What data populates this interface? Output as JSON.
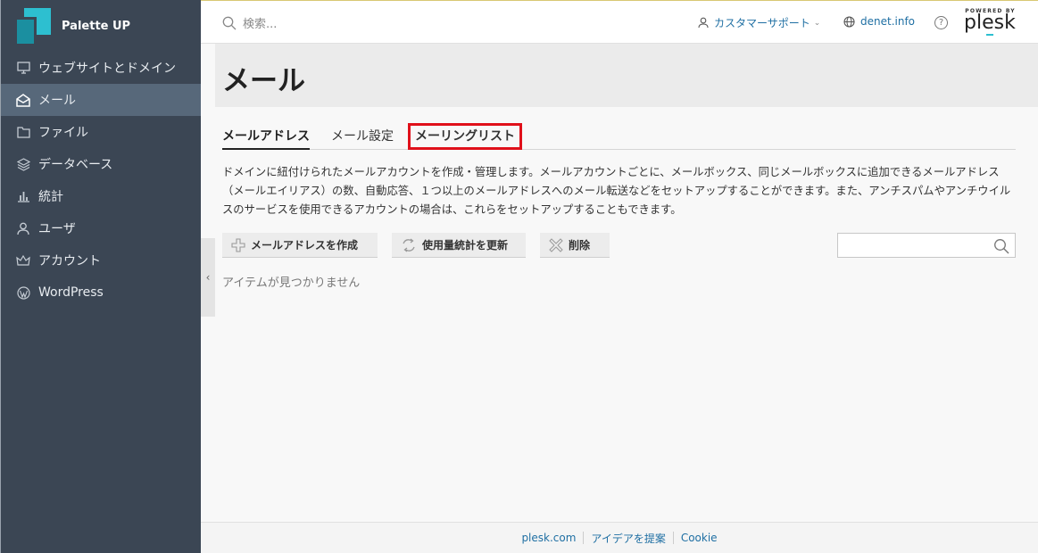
{
  "brand": {
    "name": "Palette UP"
  },
  "sidebar": {
    "items": [
      {
        "label": "ウェブサイトとドメイン",
        "icon": "monitor-icon"
      },
      {
        "label": "メール",
        "icon": "mail-icon",
        "active": true
      },
      {
        "label": "ファイル",
        "icon": "folder-icon"
      },
      {
        "label": "データベース",
        "icon": "layers-icon"
      },
      {
        "label": "統計",
        "icon": "bar-chart-icon"
      },
      {
        "label": "ユーザ",
        "icon": "user-icon"
      },
      {
        "label": "アカウント",
        "icon": "crown-icon"
      },
      {
        "label": "WordPress",
        "icon": "wordpress-icon"
      }
    ]
  },
  "header": {
    "search_placeholder": "検索...",
    "support_label": "カスタマーサポート",
    "domain_label": "denet.info",
    "help_label": "?",
    "plesk_small": "POWERED BY",
    "plesk_word": "plesk"
  },
  "main": {
    "title": "メール",
    "tabs": [
      {
        "label": "メールアドレス",
        "active": true
      },
      {
        "label": "メール設定"
      },
      {
        "label": "メーリングリスト",
        "highlighted": true
      }
    ],
    "description": "ドメインに紐付けられたメールアカウントを作成・管理します。メールアカウントごとに、メールボックス、同じメールボックスに追加できるメールアドレス（メールエイリアス）の数、自動応答、１つ以上のメールアドレスへのメール転送などをセットアップすることができます。また、アンチスパムやアンチウイルスのサービスを使用できるアカウントの場合は、これらをセットアップすることもできます。",
    "buttons": {
      "create": "メールアドレスを作成",
      "update": "使用量統計を更新",
      "delete": "削除"
    },
    "empty_message": "アイテムが見つかりません"
  },
  "footer": {
    "links": [
      "plesk.com",
      "アイデアを提案",
      "Cookie"
    ]
  },
  "colors": {
    "sidebar_bg": "#3b4654",
    "sidebar_active": "#57687a",
    "link": "#1f6fa3",
    "highlight_border": "#e0101a",
    "brand_accent": "#2dbfd0"
  }
}
